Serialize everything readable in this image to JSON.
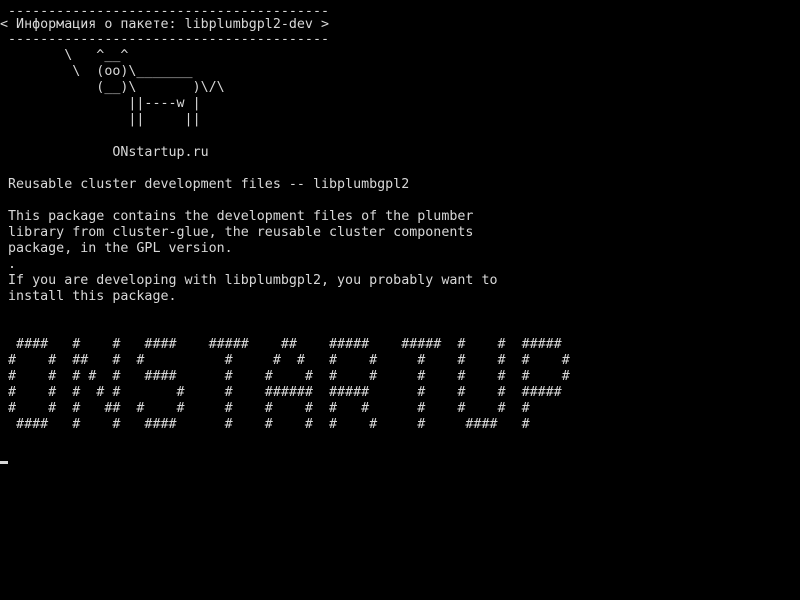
{
  "screen": {
    "background": "#000000",
    "foreground": "#d8d8d8"
  },
  "cowsay": {
    "border_top": " ----------------------------------------",
    "message": "< Информация о пакете: libplumbgpl2-dev >",
    "border_bottom": " ----------------------------------------",
    "cow": [
      "        \\   ^__^",
      "         \\  (oo)\\_______",
      "            (__)\\       )\\/\\",
      "                ||----w |",
      "                ||     ||"
    ]
  },
  "site": "              ONstartup.ru",
  "package": {
    "summary": " Reusable cluster development files -- libplumbgpl2",
    "description": [
      " This package contains the development files of the plumber",
      " library from cluster-glue, the reusable cluster components",
      " package, in the GPL version.",
      " .",
      " If you are developing with libplumbgpl2, you probably want to",
      " install this package."
    ]
  },
  "banner": [
    "  ####   #    #   ####    #####    ##    #####    #####  #    #  #####",
    " #    #  ##   #  #          #     #  #   #    #     #    #    #  #    #",
    " #    #  # #  #   ####      #    #    #  #    #     #    #    #  #    #",
    " #    #  #  # #       #     #    ######  #####      #    #    #  #####",
    " #    #  #   ##  #    #     #    #    #  #   #      #    #    #  #",
    "  ####   #    #   ####      #    #    #  #    #     #     ####   #"
  ],
  "cursor_glyph": "_"
}
